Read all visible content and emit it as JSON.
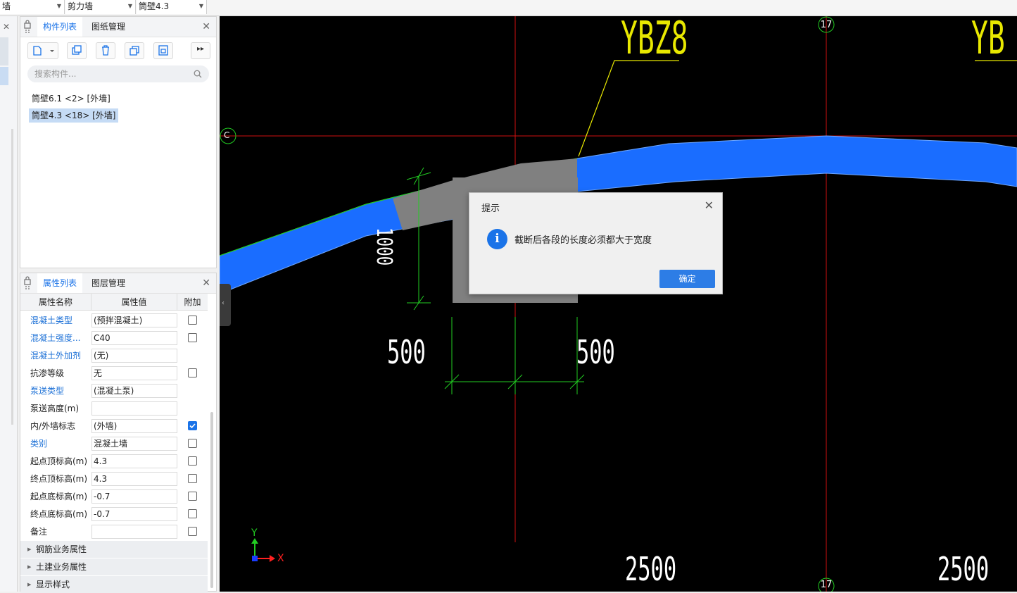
{
  "toolbar": {
    "combo1": "墙",
    "combo2": "剪力墙",
    "combo3": "筒壁4.3"
  },
  "component_panel": {
    "tab_list": "构件列表",
    "tab_drawings": "图纸管理",
    "search_placeholder": "搜索构件...",
    "items": [
      {
        "label": "筒壁6.1 <2> [外墙]",
        "selected": false
      },
      {
        "label": "筒壁4.3 <18> [外墙]",
        "selected": true
      }
    ]
  },
  "property_panel": {
    "tab_props": "属性列表",
    "tab_layers": "图层管理",
    "headers": {
      "name": "属性名称",
      "value": "属性值",
      "extra": "附加"
    },
    "rows": [
      {
        "name": "混凝土类型",
        "value": "(预拌混凝土)",
        "blue": true,
        "checkbox": true,
        "checked": false
      },
      {
        "name": "混凝土强度...",
        "value": "C40",
        "blue": true,
        "checkbox": true,
        "checked": false
      },
      {
        "name": "混凝土外加剂",
        "value": "(无)",
        "blue": true,
        "checkbox": false,
        "checked": false
      },
      {
        "name": "抗渗等级",
        "value": "无",
        "blue": false,
        "checkbox": true,
        "checked": false
      },
      {
        "name": "泵送类型",
        "value": "(混凝土泵)",
        "blue": true,
        "checkbox": false,
        "checked": false
      },
      {
        "name": "泵送高度(m)",
        "value": "",
        "blue": false,
        "checkbox": false,
        "checked": false
      },
      {
        "name": "内/外墙标志",
        "value": "(外墙)",
        "blue": false,
        "checkbox": true,
        "checked": true
      },
      {
        "name": "类别",
        "value": "混凝土墙",
        "blue": true,
        "checkbox": true,
        "checked": false
      },
      {
        "name": "起点顶标高(m)",
        "value": "4.3",
        "blue": false,
        "checkbox": true,
        "checked": false
      },
      {
        "name": "终点顶标高(m)",
        "value": "4.3",
        "blue": false,
        "checkbox": true,
        "checked": false
      },
      {
        "name": "起点底标高(m)",
        "value": "-0.7",
        "blue": false,
        "checkbox": true,
        "checked": false
      },
      {
        "name": "终点底标高(m)",
        "value": "-0.7",
        "blue": false,
        "checkbox": true,
        "checked": false
      },
      {
        "name": "备注",
        "value": "",
        "blue": false,
        "checkbox": true,
        "checked": false
      }
    ],
    "groups": [
      "钢筋业务属性",
      "土建业务属性",
      "显示样式"
    ]
  },
  "canvas": {
    "label_ybz8": "YBZ8",
    "label_yb_partial": "YB",
    "axis_17_top": "17",
    "axis_17_bottom": "17",
    "axis_c": "C",
    "dim_1000": "1000",
    "dim_500_left": "500",
    "dim_500_right": "500",
    "dim_2500_left": "2500",
    "dim_2500_right": "2500",
    "axis_x": "X",
    "axis_y": "Y",
    "colors": {
      "wall": "#1a6dff",
      "grid": "#d01010",
      "dim": "#22cc22",
      "label": "#e8e800",
      "selected_segment": "#808080"
    }
  },
  "dialog": {
    "title": "提示",
    "message": "截断后各段的长度必须都大于宽度",
    "ok_label": "确定"
  }
}
